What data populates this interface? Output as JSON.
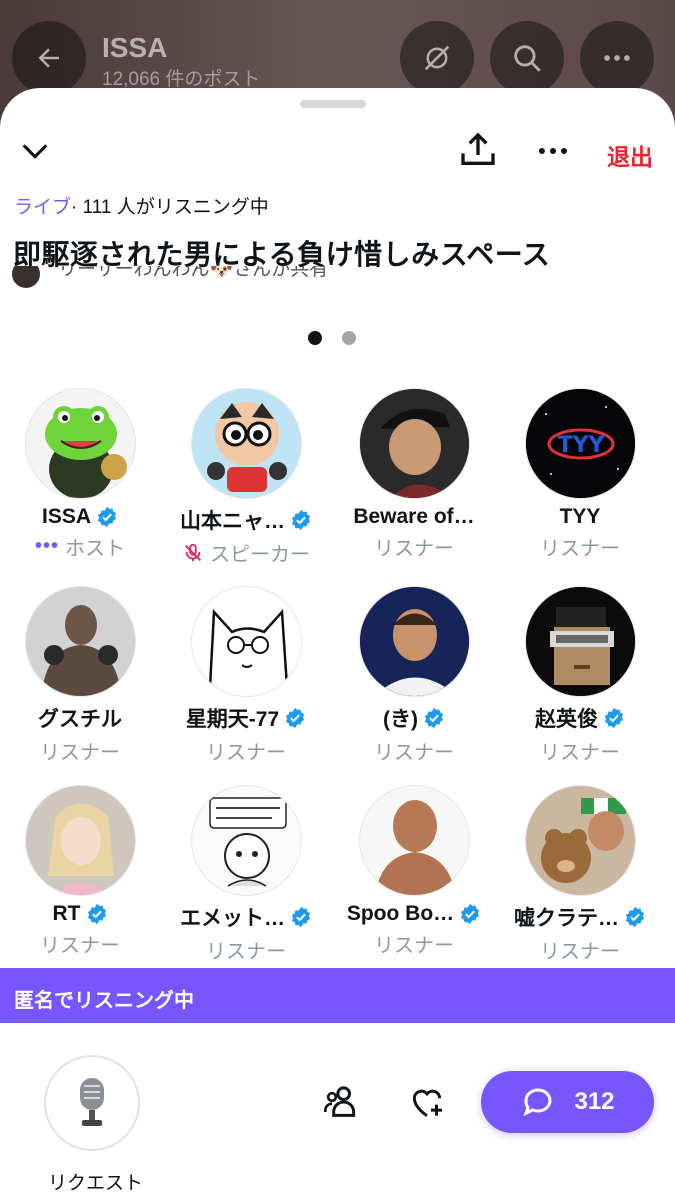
{
  "background": {
    "profile_name": "ISSA",
    "post_count": "12,066 件のポスト"
  },
  "topbar": {
    "exit_label": "退出"
  },
  "space": {
    "live_label": "ライブ",
    "listening": "· 111 人がリスニング中",
    "title": "即駆逐された男による負け惜しみスペース",
    "shared_by": "リーサーわんわん🐶さんが共有"
  },
  "participants": [
    {
      "name": "ISSA",
      "role": "ホスト",
      "role_icon": "dots-icon",
      "verified": true
    },
    {
      "name": "山本ニャ…",
      "role": "スピーカー",
      "role_icon": "mic-off-icon",
      "verified": true
    },
    {
      "name": "Beware of…",
      "role": "リスナー",
      "verified": false
    },
    {
      "name": "TYY",
      "role": "リスナー",
      "verified": false
    },
    {
      "name": "グスチル",
      "role": "リスナー",
      "verified": false
    },
    {
      "name": "星期天-77",
      "role": "リスナー",
      "verified": true
    },
    {
      "name": "(き)",
      "role": "リスナー",
      "verified": true
    },
    {
      "name": "赵英俊",
      "role": "リスナー",
      "verified": true
    },
    {
      "name": "RT",
      "role": "リスナー",
      "verified": true
    },
    {
      "name": "エメット…",
      "role": "リスナー",
      "verified": true
    },
    {
      "name": "Spoo Bo…",
      "role": "リスナー",
      "verified": true
    },
    {
      "name": "嘘クラテ…",
      "role": "リスナー",
      "verified": true
    }
  ],
  "anon_banner": "匿名でリスニング中",
  "bottom": {
    "request_label": "リクエスト",
    "comment_count": "312"
  },
  "colors": {
    "accent": "#7856ff",
    "exit": "#f4212e",
    "verified": "#1d9bf0",
    "muted": "#8b98a5"
  },
  "pager": {
    "current": 1,
    "total": 2
  }
}
